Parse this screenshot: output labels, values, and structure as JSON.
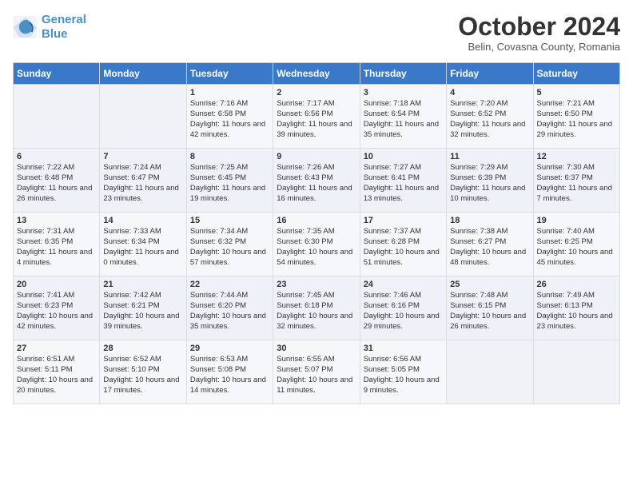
{
  "logo": {
    "line1": "General",
    "line2": "Blue"
  },
  "title": "October 2024",
  "subtitle": "Belin, Covasna County, Romania",
  "days_of_week": [
    "Sunday",
    "Monday",
    "Tuesday",
    "Wednesday",
    "Thursday",
    "Friday",
    "Saturday"
  ],
  "weeks": [
    [
      {
        "num": "",
        "info": ""
      },
      {
        "num": "",
        "info": ""
      },
      {
        "num": "1",
        "info": "Sunrise: 7:16 AM\nSunset: 6:58 PM\nDaylight: 11 hours and 42 minutes."
      },
      {
        "num": "2",
        "info": "Sunrise: 7:17 AM\nSunset: 6:56 PM\nDaylight: 11 hours and 39 minutes."
      },
      {
        "num": "3",
        "info": "Sunrise: 7:18 AM\nSunset: 6:54 PM\nDaylight: 11 hours and 35 minutes."
      },
      {
        "num": "4",
        "info": "Sunrise: 7:20 AM\nSunset: 6:52 PM\nDaylight: 11 hours and 32 minutes."
      },
      {
        "num": "5",
        "info": "Sunrise: 7:21 AM\nSunset: 6:50 PM\nDaylight: 11 hours and 29 minutes."
      }
    ],
    [
      {
        "num": "6",
        "info": "Sunrise: 7:22 AM\nSunset: 6:48 PM\nDaylight: 11 hours and 26 minutes."
      },
      {
        "num": "7",
        "info": "Sunrise: 7:24 AM\nSunset: 6:47 PM\nDaylight: 11 hours and 23 minutes."
      },
      {
        "num": "8",
        "info": "Sunrise: 7:25 AM\nSunset: 6:45 PM\nDaylight: 11 hours and 19 minutes."
      },
      {
        "num": "9",
        "info": "Sunrise: 7:26 AM\nSunset: 6:43 PM\nDaylight: 11 hours and 16 minutes."
      },
      {
        "num": "10",
        "info": "Sunrise: 7:27 AM\nSunset: 6:41 PM\nDaylight: 11 hours and 13 minutes."
      },
      {
        "num": "11",
        "info": "Sunrise: 7:29 AM\nSunset: 6:39 PM\nDaylight: 11 hours and 10 minutes."
      },
      {
        "num": "12",
        "info": "Sunrise: 7:30 AM\nSunset: 6:37 PM\nDaylight: 11 hours and 7 minutes."
      }
    ],
    [
      {
        "num": "13",
        "info": "Sunrise: 7:31 AM\nSunset: 6:35 PM\nDaylight: 11 hours and 4 minutes."
      },
      {
        "num": "14",
        "info": "Sunrise: 7:33 AM\nSunset: 6:34 PM\nDaylight: 11 hours and 0 minutes."
      },
      {
        "num": "15",
        "info": "Sunrise: 7:34 AM\nSunset: 6:32 PM\nDaylight: 10 hours and 57 minutes."
      },
      {
        "num": "16",
        "info": "Sunrise: 7:35 AM\nSunset: 6:30 PM\nDaylight: 10 hours and 54 minutes."
      },
      {
        "num": "17",
        "info": "Sunrise: 7:37 AM\nSunset: 6:28 PM\nDaylight: 10 hours and 51 minutes."
      },
      {
        "num": "18",
        "info": "Sunrise: 7:38 AM\nSunset: 6:27 PM\nDaylight: 10 hours and 48 minutes."
      },
      {
        "num": "19",
        "info": "Sunrise: 7:40 AM\nSunset: 6:25 PM\nDaylight: 10 hours and 45 minutes."
      }
    ],
    [
      {
        "num": "20",
        "info": "Sunrise: 7:41 AM\nSunset: 6:23 PM\nDaylight: 10 hours and 42 minutes."
      },
      {
        "num": "21",
        "info": "Sunrise: 7:42 AM\nSunset: 6:21 PM\nDaylight: 10 hours and 39 minutes."
      },
      {
        "num": "22",
        "info": "Sunrise: 7:44 AM\nSunset: 6:20 PM\nDaylight: 10 hours and 35 minutes."
      },
      {
        "num": "23",
        "info": "Sunrise: 7:45 AM\nSunset: 6:18 PM\nDaylight: 10 hours and 32 minutes."
      },
      {
        "num": "24",
        "info": "Sunrise: 7:46 AM\nSunset: 6:16 PM\nDaylight: 10 hours and 29 minutes."
      },
      {
        "num": "25",
        "info": "Sunrise: 7:48 AM\nSunset: 6:15 PM\nDaylight: 10 hours and 26 minutes."
      },
      {
        "num": "26",
        "info": "Sunrise: 7:49 AM\nSunset: 6:13 PM\nDaylight: 10 hours and 23 minutes."
      }
    ],
    [
      {
        "num": "27",
        "info": "Sunrise: 6:51 AM\nSunset: 5:11 PM\nDaylight: 10 hours and 20 minutes."
      },
      {
        "num": "28",
        "info": "Sunrise: 6:52 AM\nSunset: 5:10 PM\nDaylight: 10 hours and 17 minutes."
      },
      {
        "num": "29",
        "info": "Sunrise: 6:53 AM\nSunset: 5:08 PM\nDaylight: 10 hours and 14 minutes."
      },
      {
        "num": "30",
        "info": "Sunrise: 6:55 AM\nSunset: 5:07 PM\nDaylight: 10 hours and 11 minutes."
      },
      {
        "num": "31",
        "info": "Sunrise: 6:56 AM\nSunset: 5:05 PM\nDaylight: 10 hours and 9 minutes."
      },
      {
        "num": "",
        "info": ""
      },
      {
        "num": "",
        "info": ""
      }
    ]
  ]
}
